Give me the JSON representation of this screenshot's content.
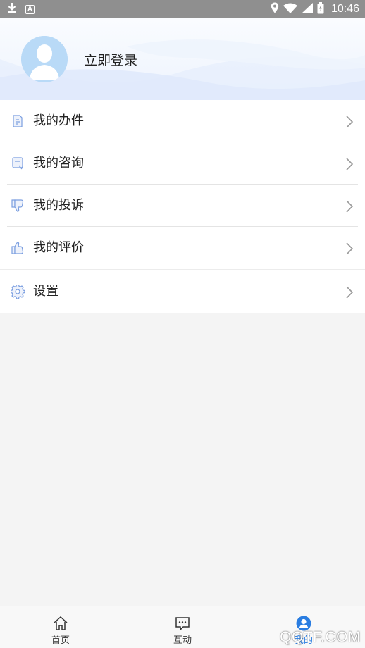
{
  "status_bar": {
    "time": "10:46",
    "left_icons": [
      "download-icon",
      "a-notification-icon"
    ],
    "right_icons": [
      "location-icon",
      "wifi-icon",
      "signal-icon",
      "battery-icon"
    ]
  },
  "profile": {
    "login_label": "立即登录",
    "avatar_icon": "user-avatar-icon"
  },
  "menu": {
    "items": [
      {
        "label": "我的办件",
        "icon": "document-icon"
      },
      {
        "label": "我的咨询",
        "icon": "consult-icon"
      },
      {
        "label": "我的投诉",
        "icon": "thumbs-down-icon"
      },
      {
        "label": "我的评价",
        "icon": "thumbs-up-icon"
      },
      {
        "label": "设置",
        "icon": "gear-icon"
      }
    ]
  },
  "tabbar": {
    "tabs": [
      {
        "label": "首页",
        "icon": "home-icon",
        "active": false
      },
      {
        "label": "互动",
        "icon": "chat-icon",
        "active": false
      },
      {
        "label": "我的",
        "icon": "person-icon",
        "active": true
      }
    ]
  },
  "watermark": "QQTF.COM",
  "colors": {
    "accent": "#2a7de1",
    "icon_blue": "#7a9ee0",
    "status_bar": "#8f8f8f",
    "avatar_bg": "#b9daf7"
  }
}
